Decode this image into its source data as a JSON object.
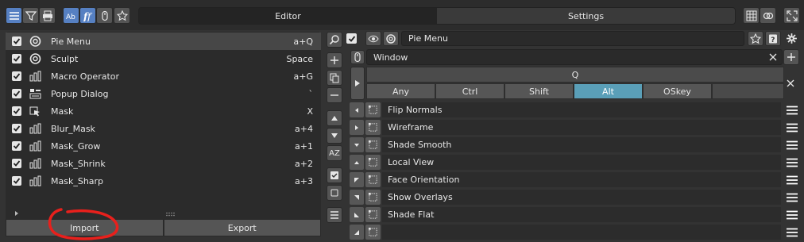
{
  "tabs": [
    {
      "label": "Editor",
      "active": true
    },
    {
      "label": "Settings",
      "active": false
    }
  ],
  "pie_menu_items": [
    {
      "label": "Pie Menu",
      "key": "a+Q",
      "icon": "pie-icon",
      "checked": true,
      "selected": true
    },
    {
      "label": "Sculpt",
      "key": "Space",
      "icon": "pie-icon",
      "checked": true,
      "selected": false
    },
    {
      "label": "Macro Operator",
      "key": "a+G",
      "icon": "macro-icon",
      "checked": true,
      "selected": false
    },
    {
      "label": "Popup Dialog",
      "key": "`",
      "icon": "popup-icon",
      "checked": true,
      "selected": false
    },
    {
      "label": "Mask",
      "key": "X",
      "icon": "sticky-icon",
      "checked": true,
      "selected": false
    },
    {
      "label": "Blur_Mask",
      "key": "a+4",
      "icon": "macro-icon",
      "checked": true,
      "selected": false
    },
    {
      "label": "Mask_Grow",
      "key": "a+1",
      "icon": "macro-icon",
      "checked": true,
      "selected": false
    },
    {
      "label": "Mask_Shrink",
      "key": "a+2",
      "icon": "macro-icon",
      "checked": true,
      "selected": false
    },
    {
      "label": "Mask_Sharp",
      "key": "a+3",
      "icon": "macro-icon",
      "checked": true,
      "selected": false
    }
  ],
  "import_label": "Import",
  "export_label": "Export",
  "sort_label": "AZ",
  "right": {
    "menu_name": "Pie Menu",
    "context": "Window",
    "key": "Q",
    "modifiers": [
      {
        "label": "Any",
        "active": false
      },
      {
        "label": "Ctrl",
        "active": false
      },
      {
        "label": "Shift",
        "active": false
      },
      {
        "label": "Alt",
        "active": true
      },
      {
        "label": "OSkey",
        "active": false
      }
    ],
    "operators": [
      {
        "label": "Flip Normals",
        "direction": "left"
      },
      {
        "label": "Wireframe",
        "direction": "right"
      },
      {
        "label": "Shade Smooth",
        "direction": "down"
      },
      {
        "label": "Local View",
        "direction": "up"
      },
      {
        "label": "Face Orientation",
        "direction": "up-left"
      },
      {
        "label": "Show Overlays",
        "direction": "up-right"
      },
      {
        "label": "Shade Flat",
        "direction": "down-left"
      },
      {
        "label": "",
        "direction": "down-right"
      }
    ]
  },
  "colors": {
    "accent_blue": "#5680c2",
    "active_modifier": "#5a9fb8",
    "annotation_red": "#e8201c"
  }
}
